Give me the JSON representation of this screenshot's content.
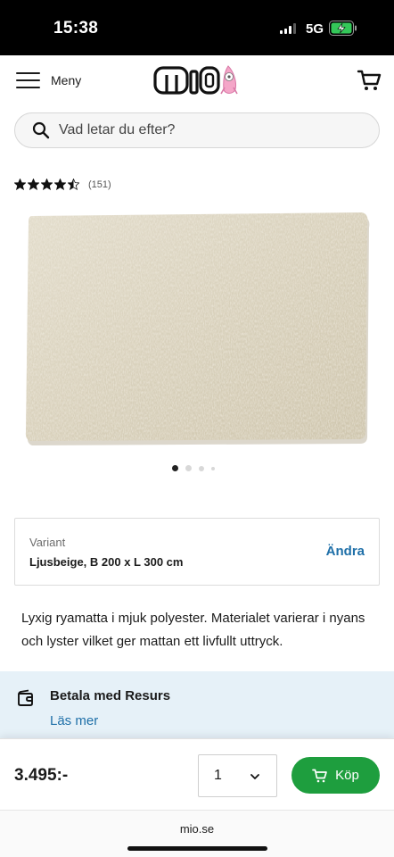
{
  "status_bar": {
    "time": "15:38",
    "network": "5G"
  },
  "header": {
    "menu_label": "Meny",
    "logo_text": "mio",
    "icons": [
      "menu-icon",
      "cart-icon"
    ]
  },
  "search": {
    "placeholder": "Vad letar du efter?"
  },
  "rating": {
    "stars": 4.5,
    "count_label": "(151)"
  },
  "gallery": {
    "image": "rug-product-image",
    "slide_count": 4,
    "active_slide": 1
  },
  "variant": {
    "label": "Variant",
    "value": "Ljusbeige, B 200 x L 300 cm",
    "change_label": "Ändra"
  },
  "description": "Lyxig ryamatta i mjuk polyester. Materialet varierar i nyans och lyster vilket ger mattan ett livfullt uttryck.",
  "payment": {
    "title": "Betala med Resurs",
    "link": "Läs mer"
  },
  "purchase": {
    "price": "3.495:-",
    "quantity": "1",
    "buy_label": "Köp"
  },
  "browser": {
    "url": "mio.se"
  },
  "colors": {
    "accent_blue": "#1e6fa8",
    "buy_green": "#1e9e3e",
    "panel_bg": "#e6f1f8",
    "logo_pink": "#f4a6c8"
  }
}
